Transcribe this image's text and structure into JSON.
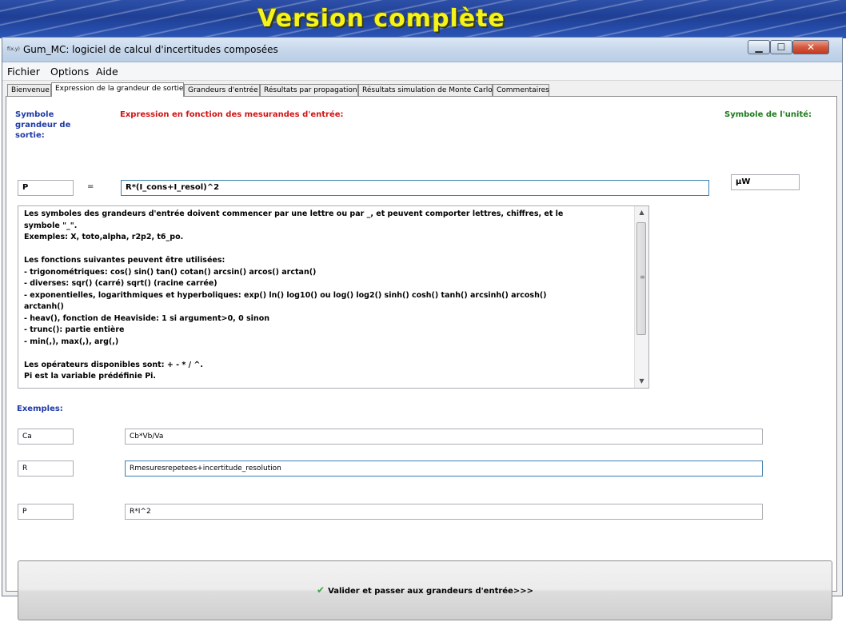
{
  "banner": {
    "title": "Version complète"
  },
  "window": {
    "title": "Gum_MC: logiciel de calcul d'incertitudes composées",
    "icon_label": "f(x,y)=",
    "controls": {
      "minimize": "▁",
      "maximize": "☐",
      "close": "✕"
    }
  },
  "menu": {
    "items": [
      "Fichier",
      "Options",
      "Aide"
    ]
  },
  "tabs": [
    {
      "label": "Bienvenue"
    },
    {
      "label": "Expression de la grandeur de sortie"
    },
    {
      "label": "Grandeurs d'entrée"
    },
    {
      "label": "Résultats par propagation"
    },
    {
      "label": "Résultats simulation de Monte Carlo"
    },
    {
      "label": "Commentaires"
    }
  ],
  "active_tab_index": 1,
  "form": {
    "output_symbol_label": "Symbole grandeur de sortie:",
    "expression_label": "Expression en fonction des mesurandes d'entrée:",
    "unit_label": "Symbole de l'unité:",
    "output_symbol_value": "P",
    "equals": "=",
    "expression_value": "R*(I_cons+I_resol)^2",
    "unit_value": "µW"
  },
  "help_text": {
    "lines": [
      "Les symboles des grandeurs d'entrée doivent commencer par une lettre ou par _, et peuvent comporter lettres, chiffres, et le symbole \"_\".",
      "Exemples: X, toto,alpha, r2p2, t6_po.",
      "",
      "Les fonctions suivantes peuvent être utilisées:",
      "- trigonométriques: cos() sin() tan() cotan() arcsin() arcos() arctan()",
      "- diverses: sqr() (carré)    sqrt() (racine carrée)",
      "- exponentielles, logarithmiques et hyperboliques: exp() ln() log10() ou log()  log2() sinh() cosh() tanh() arcsinh() arcosh() arctanh()",
      "- heav(), fonction de Heaviside: 1 si argument>0, 0 sinon",
      "- trunc(): partie entière",
      "- min(,), max(,), arg(,)",
      "",
      "Les opérateurs disponibles   sont:             +  -   *   /    ^.",
      "Pi est la variable prédéfinie Pi."
    ]
  },
  "examples": {
    "label": "Exemples:",
    "rows": [
      {
        "symbol": "Ca",
        "expression": "Cb*Vb/Va"
      },
      {
        "symbol": "R",
        "expression": "Rmesuresrepetees+incertitude_resolution"
      },
      {
        "symbol": "P",
        "expression": "R*I^2"
      }
    ]
  },
  "validate_button": {
    "label": "Valider et passer aux grandeurs d'entrée>>>",
    "icon": "check-icon"
  },
  "colors": {
    "blue_label": "#1f3aa8",
    "red_label": "#d21414",
    "green_label": "#1d7a1d",
    "banner_text": "#f4f41a"
  }
}
